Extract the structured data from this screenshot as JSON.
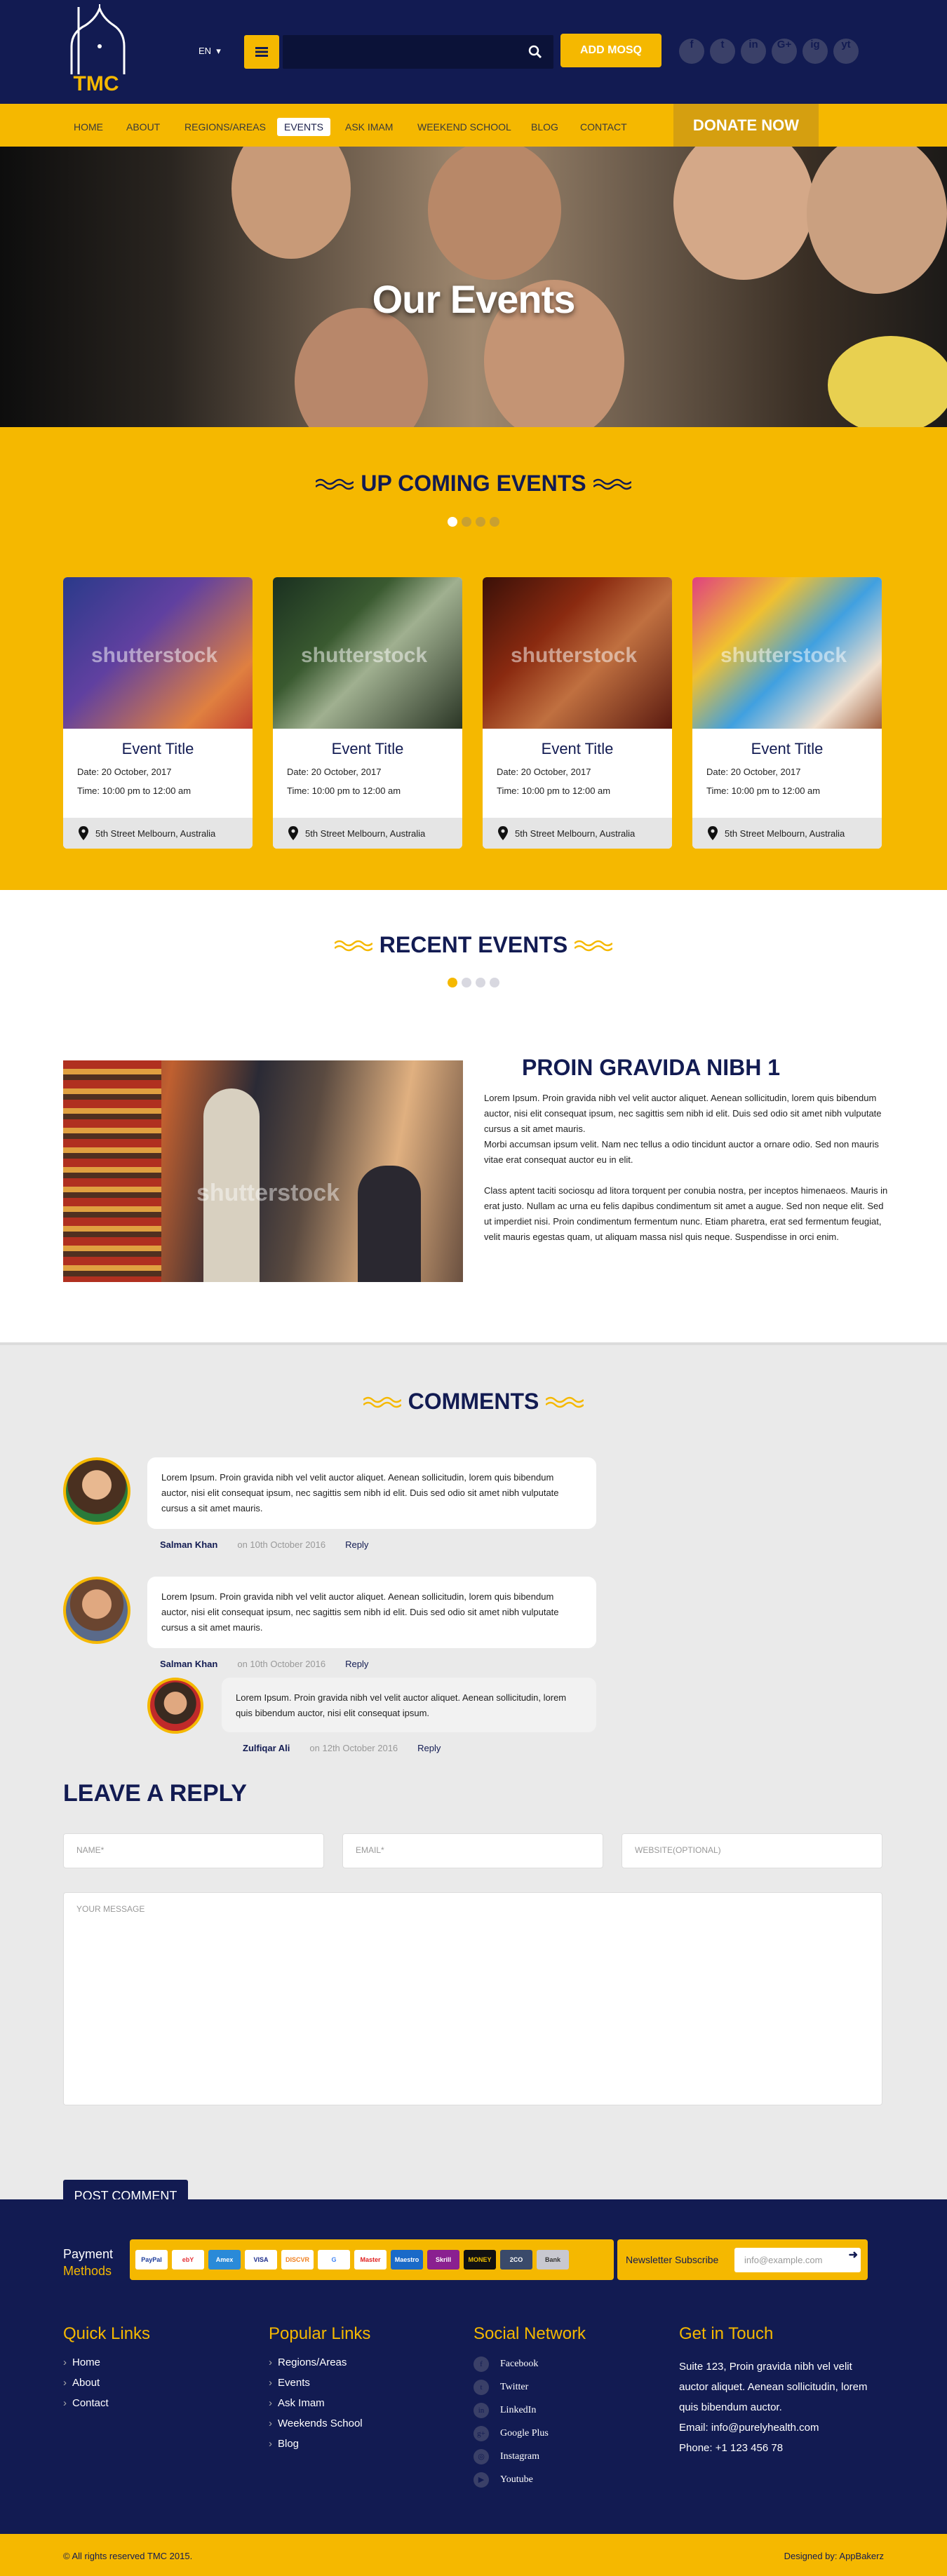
{
  "header": {
    "logo_text": "TMC",
    "lang": "EN",
    "search_placeholder": "",
    "add_mosque": "ADD MOSQ",
    "social": [
      "f",
      "t",
      "in",
      "G+",
      "ig",
      "yt"
    ]
  },
  "nav": {
    "items": [
      "HOME",
      "ABOUT",
      "REGIONS/AREAS",
      "EVENTS",
      "ASK IMAM",
      "WEEKEND SCHOOL",
      "BLOG",
      "CONTACT"
    ],
    "active": "EVENTS",
    "donate": "DONATE NOW"
  },
  "hero": {
    "title": "Our Events"
  },
  "upcoming": {
    "title": "UP COMING EVENTS",
    "events": [
      {
        "title": "Event Title",
        "date": "Date: 20 October, 2017",
        "time": "Time: 10:00 pm to 12:00 am",
        "location": "5th Street Melbourn, Australia"
      },
      {
        "title": "Event Title",
        "date": "Date: 20 October, 2017",
        "time": "Time: 10:00 pm to 12:00 am",
        "location": "5th Street Melbourn, Australia"
      },
      {
        "title": "Event Title",
        "date": "Date: 20 October, 2017",
        "time": "Time: 10:00 pm to 12:00 am",
        "location": "5th Street Melbourn, Australia"
      },
      {
        "title": "Event Title",
        "date": "Date: 20 October, 2017",
        "time": "Time: 10:00 pm to 12:00 am",
        "location": "5th Street Melbourn, Australia"
      }
    ],
    "watermark": "shutterstock"
  },
  "recent": {
    "title": "RECENT EVENTS",
    "article_title": "PROIN GRAVIDA NIBH 1",
    "p1": "Lorem Ipsum. Proin gravida nibh vel velit auctor aliquet. Aenean sollicitudin, lorem quis bibendum auctor, nisi elit consequat ipsum, nec sagittis sem nibh id elit. Duis sed odio sit amet nibh vulputate cursus a sit amet mauris.",
    "p2": "Morbi accumsan ipsum velit. Nam nec tellus a odio tincidunt auctor a ornare odio. Sed non mauris vitae erat consequat auctor eu in elit.",
    "p3": "Class aptent taciti sociosqu ad litora torquent per conubia nostra, per inceptos himenaeos. Mauris in erat justo. Nullam ac urna eu felis dapibus condimentum sit amet a augue. Sed non neque elit. Sed ut imperdiet nisi. Proin condimentum fermentum nunc. Etiam pharetra, erat sed fermentum feugiat, velit mauris egestas quam, ut aliquam massa nisl quis neque. Suspendisse in orci enim."
  },
  "comments": {
    "title": "COMMENTS",
    "list": [
      {
        "text": "Lorem Ipsum. Proin gravida nibh vel velit auctor aliquet. Aenean sollicitudin, lorem quis bibendum auctor, nisi elit consequat ipsum, nec sagittis sem nibh id elit. Duis sed odio sit amet nibh vulputate cursus a sit amet mauris.",
        "name": "Salman Khan",
        "date": "on 10th October 2016",
        "reply": "Reply"
      },
      {
        "text": "Lorem Ipsum. Proin gravida nibh vel velit auctor aliquet. Aenean sollicitudin, lorem quis bibendum auctor, nisi elit consequat ipsum, nec sagittis sem nibh id elit. Duis sed odio sit amet nibh vulputate cursus a sit amet mauris.",
        "name": "Salman Khan",
        "date": "on 10th October 2016",
        "reply": "Reply"
      },
      {
        "text": "Lorem Ipsum. Proin gravida nibh vel velit auctor aliquet. Aenean sollicitudin, lorem quis bibendum auctor, nisi elit consequat ipsum.",
        "name": "Zulfiqar Ali",
        "date": "on 12th October 2016",
        "reply": "Reply"
      }
    ]
  },
  "reply": {
    "title": "LEAVE A REPLY",
    "name_ph": "NAME*",
    "email_ph": "EMAIL*",
    "website_ph": "WEBSITE(OPTIONAL)",
    "message_ph": "YOUR MESSAGE",
    "submit": "POST COMMENT"
  },
  "footer": {
    "payment_1": "Payment",
    "payment_2": "Methods",
    "payment_cards": [
      "PayPal",
      "ebY",
      "Amex",
      "VISA",
      "DISCVR",
      "G",
      "Master",
      "Maestro",
      "Skrill",
      "MONEY",
      "2CO",
      "Bank"
    ],
    "newsletter_label": "Newsletter Subscribe",
    "newsletter_ph": "info@example.com",
    "quick_links_title": "Quick Links",
    "quick_links": [
      "Home",
      "About",
      "Contact"
    ],
    "popular_title": "Popular Links",
    "popular": [
      "Regions/Areas",
      "Events",
      "Ask Imam",
      "Weekends School",
      "Blog"
    ],
    "social_title": "Social Network",
    "social": [
      "Facebook",
      "Twitter",
      "LinkedIn",
      "Google Plus",
      "Instagram",
      "Youtube"
    ],
    "touch_title": "Get in Touch",
    "touch_address": "Suite 123, Proin gravida nibh vel velit auctor aliquet. Aenean sollicitudin, lorem quis bibendum auctor.",
    "touch_email": "Email: info@purelyhealth.com",
    "touch_phone": "Phone: +1 123 456 78",
    "copyright": "© All rights reserved TMC 2015.",
    "designed": "Designed by: AppBakerz"
  },
  "colors": {
    "navy": "#121b52",
    "yellow": "#f5b800",
    "gray": "#eaeaea"
  }
}
